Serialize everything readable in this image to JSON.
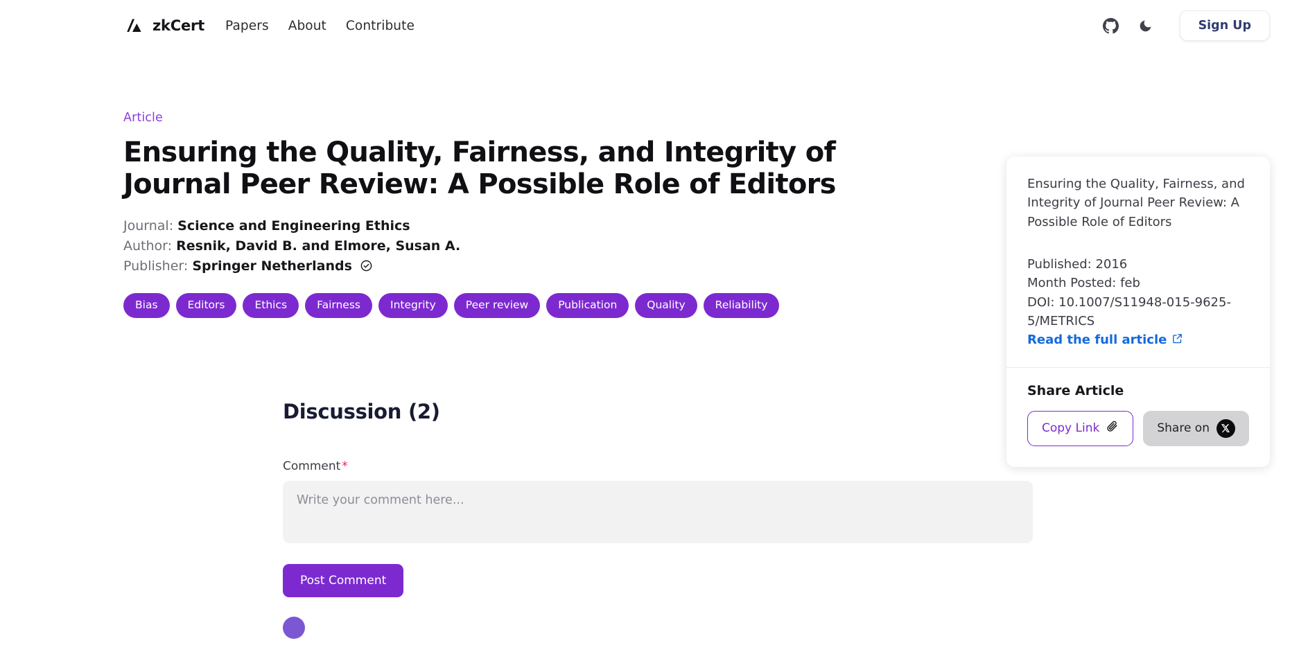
{
  "header": {
    "logo_icon": "slash-triangle-logo-icon",
    "brand": "zkCert",
    "nav": [
      {
        "label": "Papers"
      },
      {
        "label": "About"
      },
      {
        "label": "Contribute"
      }
    ],
    "github_icon": "github-icon",
    "theme_icon": "moon-icon",
    "signup_label": "Sign Up"
  },
  "article": {
    "kicker": "Article",
    "title": "Ensuring the Quality, Fairness, and Integrity of Journal Peer Review: A Possible Role of Editors",
    "journal_label": "Journal:",
    "journal_value": "Science and Engineering Ethics",
    "author_label": "Author:",
    "author_value": "Resnik, David B. and Elmore, Susan A.",
    "publisher_label": "Publisher:",
    "publisher_value": "Springer Netherlands",
    "verified_icon": "verified-check-icon",
    "tags": [
      "Bias",
      "Editors",
      "Ethics",
      "Fairness",
      "Integrity",
      "Peer review",
      "Publication",
      "Quality",
      "Reliability"
    ]
  },
  "side_card": {
    "title": "Ensuring the Quality, Fairness, and Integrity of Journal Peer Review: A Possible Role of Editors",
    "published": "Published: 2016",
    "month_posted": "Month Posted: feb",
    "doi": "DOI: 10.1007/S11948-015-9625-5/METRICS",
    "read_link": "Read the full article",
    "read_link_icon": "external-link-icon",
    "share_heading": "Share Article",
    "copy_link_label": "Copy Link",
    "copy_link_icon": "paperclip-icon",
    "share_x_label": "Share on",
    "share_x_icon": "x-logo-icon"
  },
  "discussion": {
    "heading": "Discussion (2)",
    "comment_label": "Comment",
    "required_mark": "*",
    "comment_placeholder": "Write your comment here...",
    "comment_value": "",
    "post_label": "Post Comment"
  },
  "colors": {
    "brand_purple": "#7c2ad0",
    "kicker_purple": "#8b3fd8",
    "link_blue": "#1569dd",
    "signup_navy": "#2f3c70",
    "required_red": "#e0295c"
  }
}
